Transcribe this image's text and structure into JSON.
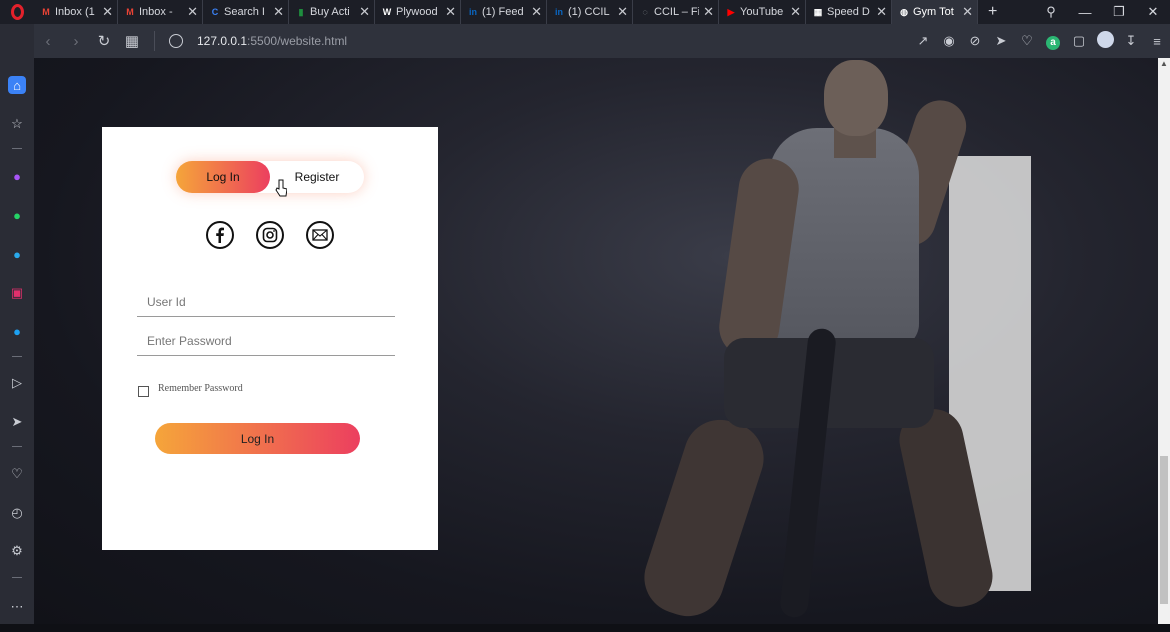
{
  "browser": {
    "tabs": [
      {
        "title": "Inbox (1",
        "favicon": "gmail-icon",
        "color": "#ea4335",
        "active": false
      },
      {
        "title": "Inbox - ",
        "favicon": "gmail-icon",
        "color": "#ea4335",
        "active": false
      },
      {
        "title": "Search I",
        "favicon": "search-icon",
        "color": "#3b82f6",
        "active": false
      },
      {
        "title": "Buy Acti",
        "favicon": "chart-icon",
        "color": "#1e8e3e",
        "active": false
      },
      {
        "title": "Plywood",
        "favicon": "wk-icon",
        "color": "#ffffff",
        "active": false
      },
      {
        "title": "(1) Feed",
        "favicon": "linkedin-icon",
        "color": "#0a66c2",
        "active": false
      },
      {
        "title": "(1) CCIL",
        "favicon": "linkedin-icon",
        "color": "#0a66c2",
        "active": false
      },
      {
        "title": "CCIL – Fi",
        "favicon": "loading-icon",
        "color": "#9aa0a6",
        "active": false
      },
      {
        "title": "YouTube",
        "favicon": "youtube-icon",
        "color": "#ff0000",
        "active": false
      },
      {
        "title": "Speed D",
        "favicon": "grid-icon",
        "color": "#ffffff",
        "active": false
      },
      {
        "title": "Gym Tot",
        "favicon": "globe-icon",
        "color": "#ffffff",
        "active": true
      }
    ],
    "new_tab": "+",
    "url_host": "127.0.0.1",
    "url_rest": ":5500/website.html"
  },
  "login": {
    "toggle_login": "Log In",
    "toggle_register": "Register",
    "social_icons": [
      "facebook-icon",
      "instagram-icon",
      "mail-icon"
    ],
    "userid_placeholder": "User Id",
    "password_placeholder": "Enter Password",
    "remember_label": "Remember Password",
    "submit_label": "Log In"
  },
  "colors": {
    "gradient_start": "#f5a53a",
    "gradient_end": "#ec3f5f",
    "opera_red": "#e3212b"
  }
}
